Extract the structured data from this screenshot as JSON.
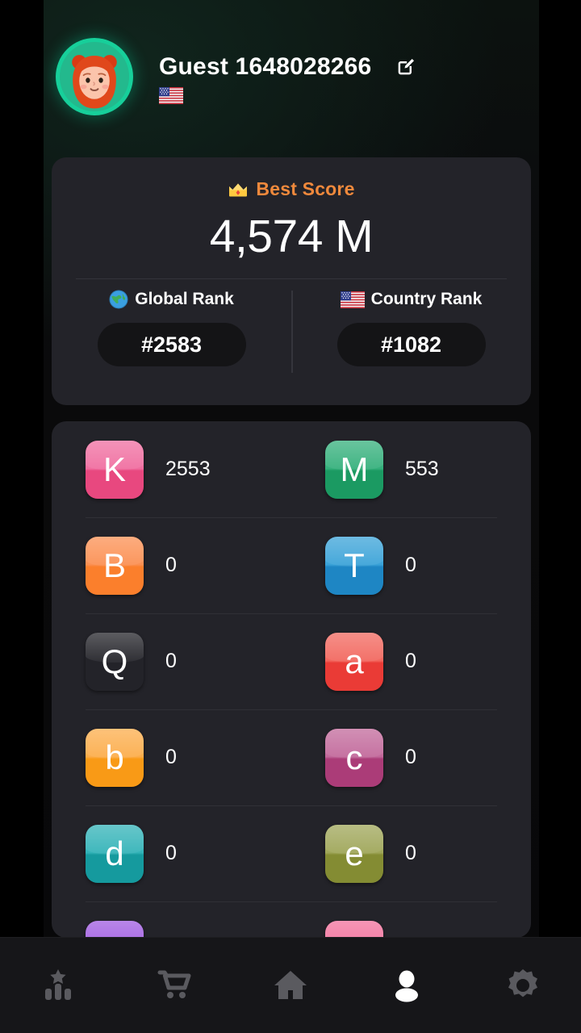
{
  "header": {
    "username": "Guest 1648028266",
    "avatar_icon": "girl-avatar",
    "edit_icon": "edit-pencil-icon",
    "country_flag_icon": "us-flag-icon"
  },
  "score_card": {
    "crown_icon": "crown-icon",
    "best_score_label": "Best Score",
    "best_score_value": "4,574 M",
    "accent_color": "#f0893c",
    "global": {
      "icon": "globe-icon",
      "label": "Global Rank",
      "value": "#2583"
    },
    "country": {
      "icon": "us-flag-icon",
      "label": "Country Rank",
      "value": "#1082"
    }
  },
  "letters": {
    "rows": [
      [
        {
          "letter": "K",
          "value": "2553",
          "top": "#f06ea0",
          "bottom": "#e8487f"
        },
        {
          "letter": "M",
          "value": "553",
          "top": "#35b07c",
          "bottom": "#1b9a62"
        }
      ],
      [
        {
          "letter": "B",
          "value": "0",
          "top": "#fb9053",
          "bottom": "#fb7f2c"
        },
        {
          "letter": "T",
          "value": "0",
          "top": "#3ba3d8",
          "bottom": "#1e86c4"
        }
      ],
      [
        {
          "letter": "Q",
          "value": "0",
          "top": "#b martial",
          "bottom": "#9a2fe0"
        },
        {
          "letter": "a",
          "value": "0",
          "top": "#f2685f",
          "bottom": "#ea3b36"
        }
      ],
      [
        {
          "letter": "b",
          "value": "0",
          "top": "#fcad4b",
          "bottom": "#f99a16"
        },
        {
          "letter": "c",
          "value": "0",
          "top": "#c2699b",
          "bottom": "#ab3c78"
        }
      ],
      [
        {
          "letter": "d",
          "value": "0",
          "top": "#33b3b8",
          "bottom": "#159a9e"
        },
        {
          "letter": "e",
          "value": "0",
          "top": "#9fa659",
          "bottom": "#848c33"
        }
      ],
      [
        {
          "letter": "",
          "value": "",
          "top": "#a05ce0",
          "bottom": "#8b3fd6"
        },
        {
          "letter": "",
          "value": "",
          "top": "#f2719c",
          "bottom": "#ec4f82"
        }
      ]
    ]
  },
  "nav": {
    "items": [
      {
        "icon": "leaderboard-icon",
        "active": false
      },
      {
        "icon": "cart-icon",
        "active": false
      },
      {
        "icon": "home-icon",
        "active": false
      },
      {
        "icon": "person-icon",
        "active": true
      },
      {
        "icon": "gear-icon",
        "active": false
      }
    ],
    "inactive_color": "#5a5a5f",
    "active_color": "#ffffff"
  }
}
